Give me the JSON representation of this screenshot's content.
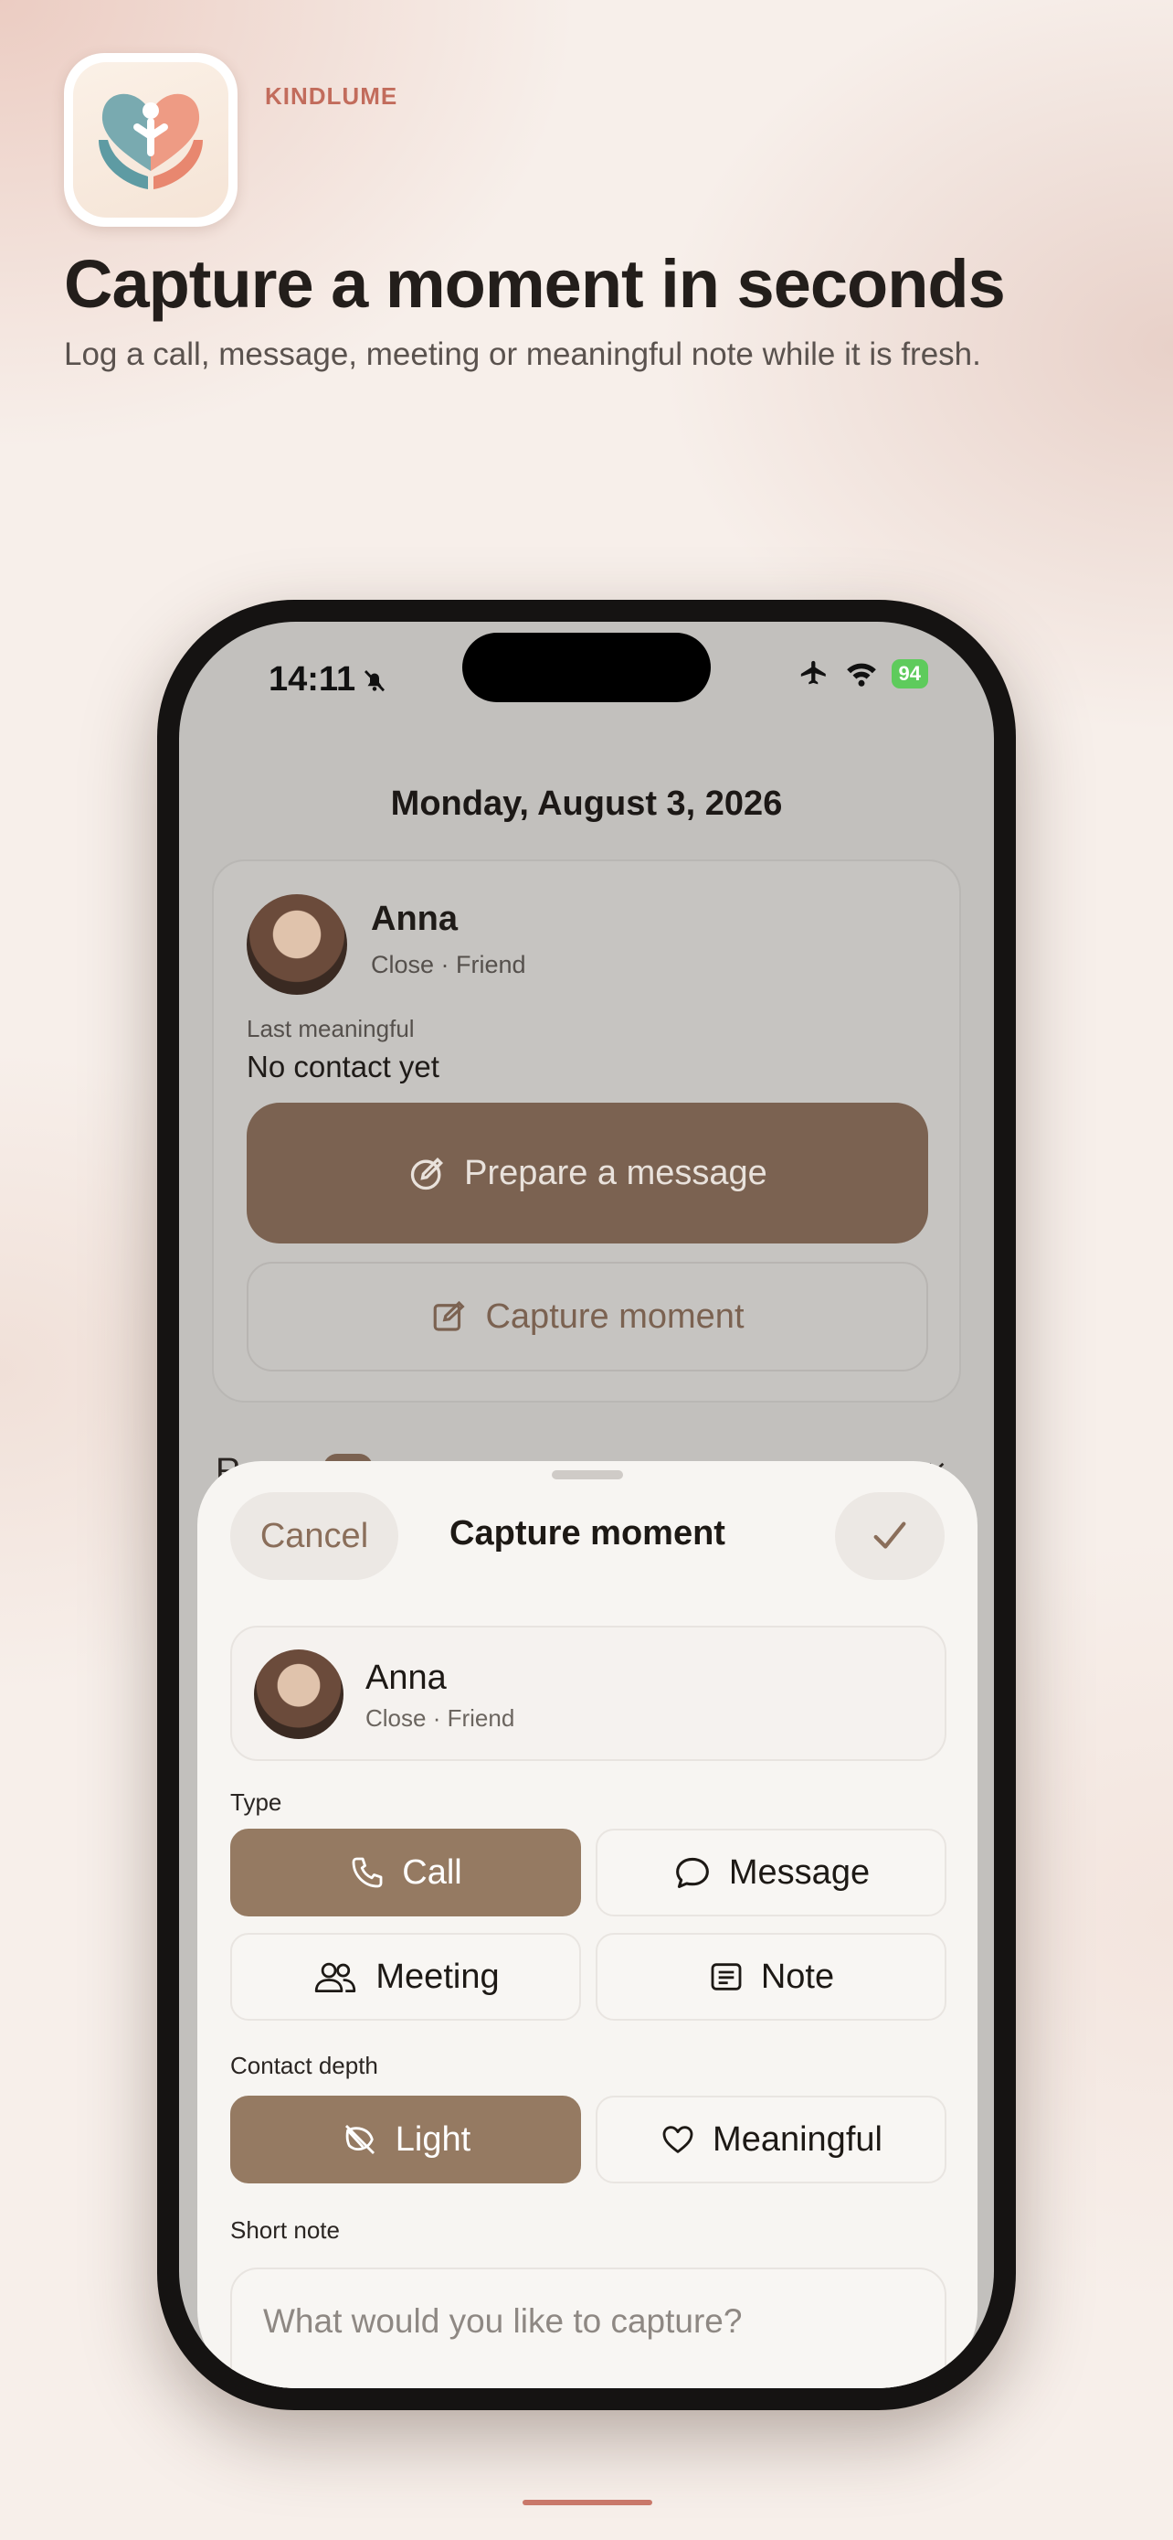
{
  "brand": {
    "name": "KINDLUME"
  },
  "hero": {
    "headline": "Capture a moment in seconds",
    "subhead": "Log a call, message, meeting or meaningful note while it is fresh."
  },
  "status_bar": {
    "time": "14:11",
    "battery": "94"
  },
  "background_screen": {
    "date": "Monday, August 3, 2026",
    "contact": {
      "name": "Anna",
      "relation": "Close · Friend"
    },
    "last_meaningful_label": "Last meaningful",
    "last_meaningful_value": "No contact yet",
    "prepare_button": "Prepare a message",
    "capture_button": "Capture moment"
  },
  "sheet": {
    "cancel": "Cancel",
    "title": "Capture moment",
    "contact": {
      "name": "Anna",
      "relation": "Close · Friend"
    },
    "type_label": "Type",
    "types": [
      {
        "label": "Call",
        "icon": "phone-icon",
        "selected": true
      },
      {
        "label": "Message",
        "icon": "chat-bubble-icon",
        "selected": false
      },
      {
        "label": "Meeting",
        "icon": "people-icon",
        "selected": false
      },
      {
        "label": "Note",
        "icon": "note-icon",
        "selected": false
      }
    ],
    "depth_label": "Contact depth",
    "depths": [
      {
        "label": "Light",
        "icon": "leaf-icon",
        "selected": true
      },
      {
        "label": "Meaningful",
        "icon": "heart-icon",
        "selected": false
      }
    ],
    "note_label": "Short note",
    "note_placeholder": "What would you like to capture?",
    "note_value": ""
  },
  "colors": {
    "accent": "#957a62",
    "accent_dark": "#7b6251",
    "brand_text": "#c26c5c",
    "battery": "#5ecb5c"
  }
}
